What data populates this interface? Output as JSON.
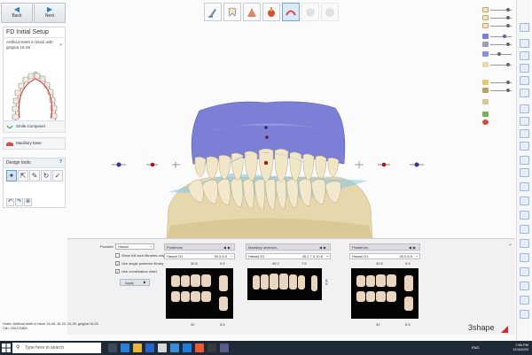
{
  "nav": {
    "back_label": "Back",
    "next_label": "Next"
  },
  "setup": {
    "title": "FD Initial Setup",
    "selection": "Artificial teeth in block with gingiva 16-26"
  },
  "items": {
    "smile_composer": "Smile Composer",
    "maxillary_base": "Maxillary base"
  },
  "design_tools": {
    "title": "Design tools",
    "help": "?"
  },
  "library": {
    "provider_label": "Provider",
    "provider_value": "Hassel",
    "checkboxes": [
      {
        "label": "Show full arch libraries only",
        "checked": false
      },
      {
        "label": "Use single posterior library",
        "checked": true
      },
      {
        "label": "Use combination chart",
        "checked": true
      }
    ],
    "apply_label": "Apply",
    "cards": [
      {
        "header": "Posteriors",
        "field": "Hassel D1",
        "field_value": "30.5  8.5",
        "num_left": "30.5",
        "num_right": "9.5",
        "bot_left": "32",
        "bot_right": "5.5"
      },
      {
        "header": "Maxillary anteriors",
        "field": "Hassel D1",
        "field_value": "45.2  7.9  10.8",
        "num_left": "45.2",
        "num_right": "7.5",
        "side_label": "10.8"
      },
      {
        "header": "Posteriors",
        "field": "Hassel D1",
        "field_value": "30.5  8.5",
        "num_left": "30.5",
        "num_right": "9.5",
        "bot_left": "32",
        "bot_right": "5.5"
      }
    ]
  },
  "order_info": {
    "order": "Order: Artificial teeth in block 16-26, 16-23, 24-26, gingiva 16-26",
    "client": "Clin: 234172883"
  },
  "brand": {
    "name": "3shape"
  },
  "taskbar": {
    "search_placeholder": "Type here to search",
    "lang": "ENG",
    "time": "7:56 PM",
    "date": "12/4/2023"
  },
  "colors": {
    "gingiva": "#7b7fd6",
    "teeth": "#efe4c4",
    "model": "#e8dbb2",
    "accent": "#2f7cc6",
    "taskbar": "#1f2a38"
  }
}
